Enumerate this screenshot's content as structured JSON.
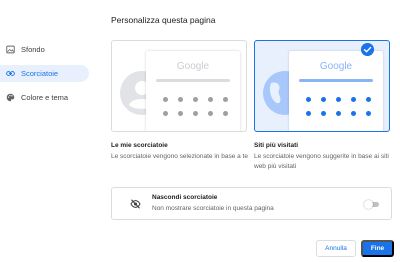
{
  "page": {
    "title": "Personalizza questa pagina"
  },
  "sidebar": {
    "items": [
      {
        "label": "Sfondo",
        "icon": "background-icon"
      },
      {
        "label": "Scorciatoie",
        "icon": "link-icon"
      },
      {
        "label": "Colore e tema",
        "icon": "palette-icon"
      }
    ]
  },
  "options": {
    "my_shortcuts": {
      "brand": "Google",
      "title": "Le mie scorciatoie",
      "description": "Le scorciatoie vengono selezionate in base a te"
    },
    "most_visited": {
      "brand": "Google",
      "title": "Siti più visitati",
      "description": "Le scorciatoie vengono suggerite in base ai siti web più visitati",
      "selected": true
    }
  },
  "hide_shortcuts": {
    "title": "Nascondi scorciatoie",
    "description": "Non mostrare scorciatoie in questa pagina",
    "enabled": false,
    "icon": "eye-off-icon"
  },
  "buttons": {
    "cancel": "Annulla",
    "done": "Fine"
  },
  "colors": {
    "accent": "#1a73e8",
    "accent_light": "#e8f0fe"
  }
}
